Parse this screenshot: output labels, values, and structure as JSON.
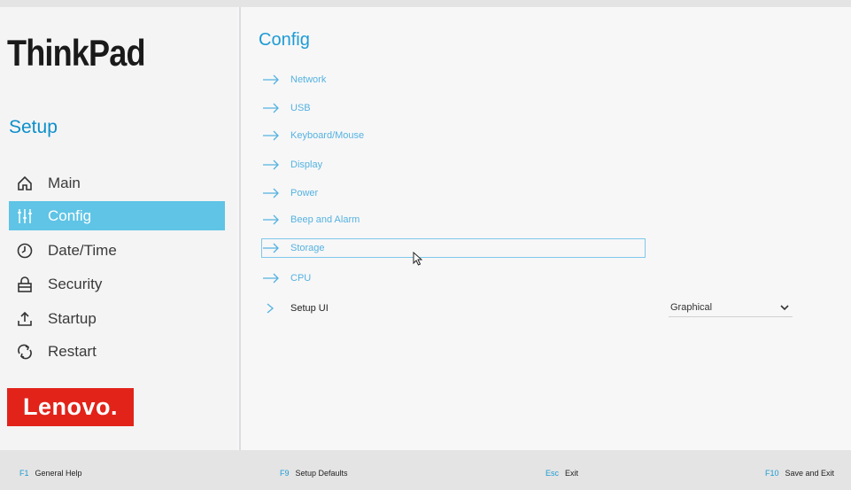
{
  "sidebar": {
    "brand": "ThinkPad",
    "setup_title": "Setup",
    "items": [
      {
        "label": "Main",
        "icon": "home-icon",
        "active": false
      },
      {
        "label": "Config",
        "icon": "sliders-icon",
        "active": true
      },
      {
        "label": "Date/Time",
        "icon": "clock-icon",
        "active": false
      },
      {
        "label": "Security",
        "icon": "lock-icon",
        "active": false
      },
      {
        "label": "Startup",
        "icon": "upload-icon",
        "active": false
      },
      {
        "label": "Restart",
        "icon": "refresh-icon",
        "active": false
      }
    ],
    "vendor_logo": "Lenovo."
  },
  "main": {
    "title": "Config",
    "items": [
      {
        "label": "Network"
      },
      {
        "label": "USB"
      },
      {
        "label": "Keyboard/Mouse"
      },
      {
        "label": "Display"
      },
      {
        "label": "Power"
      },
      {
        "label": "Beep and Alarm"
      },
      {
        "label": "Storage",
        "selected": true
      },
      {
        "label": "CPU"
      }
    ],
    "setup_ui": {
      "label": "Setup UI",
      "value": "Graphical"
    }
  },
  "footer": {
    "keys": [
      {
        "key": "F1",
        "label": "General Help"
      },
      {
        "key": "F9",
        "label": "Setup Defaults"
      },
      {
        "key": "Esc",
        "label": "Exit"
      },
      {
        "key": "F10",
        "label": "Save and Exit"
      }
    ]
  },
  "colors": {
    "accent": "#1e9bd3",
    "active_bg": "#5fc4e6",
    "lenovo_red": "#e2231a"
  }
}
